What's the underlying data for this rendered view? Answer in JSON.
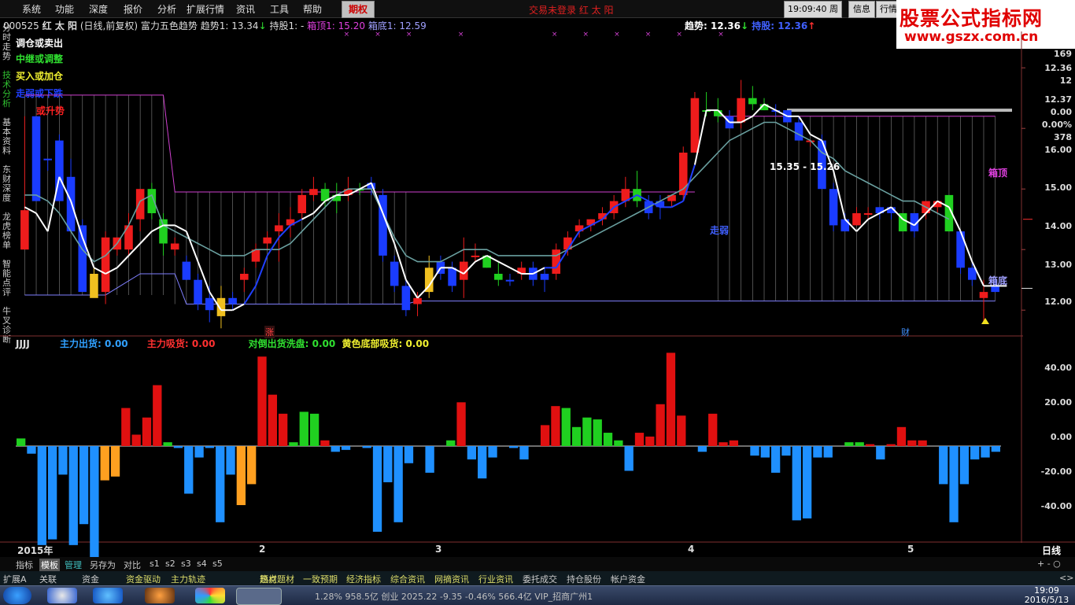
{
  "menubar": {
    "items": [
      "系统",
      "功能",
      "深度",
      "报价",
      "分析",
      "扩展行情",
      "资讯",
      "工具",
      "帮助"
    ],
    "active_tab": "期权",
    "status": "交易未登录   红 太 阳",
    "clock": "19:09:40",
    "weekday": "周五",
    "right_buttons": [
      "信息",
      "行情"
    ]
  },
  "logo": {
    "title": "股票公式指标网",
    "url": "www.gszx.com.cn"
  },
  "left_tabs": [
    "分时走势",
    "技术分析",
    "基本资料",
    "东财深度",
    "龙虎榜单",
    "智能点评",
    "牛叉诊断"
  ],
  "info": {
    "code": "000525",
    "name": "红 太 阳",
    "period": "(日线,前复权)",
    "indicator": "富力五色趋势",
    "trend_label": "趋势1:",
    "trend_value": "13.34",
    "hold_label": "持股1:",
    "hold_value": "-",
    "top_label": "箱顶1:",
    "top_value": "15.20",
    "bottom_label": "箱底1:",
    "bottom_value": "12.59",
    "trend2_label": "趋势:",
    "trend2_value": "12.36",
    "hold2_label": "持股:",
    "hold2_value": "12.36"
  },
  "legend": [
    {
      "text": "调仓或卖出",
      "color": "#ffffff"
    },
    {
      "text": "中继或调整",
      "color": "#30e030"
    },
    {
      "text": "买入或加仓",
      "color": "#f0f030"
    },
    {
      "text": "走弱或下跌",
      "color": "#2040ff"
    },
    {
      "text": "或升势",
      "color": "#ff2020"
    }
  ],
  "annotations": {
    "range_label": "15.35 - 15.26",
    "box_top": "箱顶",
    "box_bottom": "箱底",
    "trend_tag": "走弱",
    "zhang": "涨",
    "cai": "财"
  },
  "right_scale": [
    "169",
    "12.36",
    "12",
    "12.37",
    "0.00",
    "0.00%",
    "378",
    "16.00",
    "15.00",
    "14.00",
    "13.00",
    "12.00"
  ],
  "sub_indicator": {
    "name": "JJJJ",
    "main_out_label": "主力出货:",
    "main_out_value": "0.00",
    "main_in_label": "主力吸货:",
    "main_in_value": "0.00",
    "wash_label": "对倒出货洗盘:",
    "wash_value": "0.00",
    "yellow_label": "黄色底部吸货:",
    "yellow_value": "0.00",
    "ticks": [
      "40.00",
      "20.00",
      "0.00",
      "-20.00",
      "-40.00"
    ]
  },
  "x_axis": {
    "year": "2015年",
    "months": [
      "2",
      "3",
      "4",
      "5"
    ],
    "right_label": "日线"
  },
  "toolbar2": {
    "items": [
      "指标",
      "模板",
      "管理",
      "另存为",
      "对比",
      "s1",
      "s2",
      "s3",
      "s4",
      "s5"
    ],
    "right": "+ - ○"
  },
  "linkbar": {
    "items": [
      "扩展A",
      "关联",
      "资金",
      "资金驱动",
      "主力轨迹",
      "",
      "题材",
      "热点题材",
      "一致预期",
      "经济指标",
      "综合资讯",
      "网摘资讯",
      "行业资讯",
      "委托成交",
      "持仓股份",
      "帐户资金"
    ],
    "right": "<>"
  },
  "ticker": {
    "text": "1.28%   958.5亿   创业 2025.22   -9.35   -0.46%   566.4亿   VIP_招商广州1"
  },
  "taskbar": {
    "time": "19:09",
    "date": "2016/5/13"
  },
  "chart_data": [
    {
      "type": "candlestick",
      "title": "",
      "ylim": [
        11.6,
        16.6
      ],
      "y_ticks": [
        16,
        15,
        14,
        13,
        12
      ],
      "ohlc": [
        [
          13.65,
          15.2,
          13.2,
          13.0,
          "u"
        ],
        [
          15.2,
          15.2,
          13.8,
          13.8,
          "d"
        ],
        [
          14.5,
          14.5,
          14.3,
          14.5,
          "d"
        ],
        [
          14.8,
          14.9,
          13.8,
          13.8,
          "d"
        ],
        [
          14.2,
          14.5,
          13.4,
          13.3,
          "d"
        ],
        [
          13.4,
          13.5,
          12.4,
          12.3,
          "d"
        ],
        [
          12.6,
          12.7,
          12.3,
          12.2,
          "y"
        ],
        [
          12.3,
          13.3,
          12.1,
          13.2,
          "u"
        ],
        [
          13.0,
          13.2,
          12.9,
          13.2,
          "u"
        ],
        [
          13.0,
          13.6,
          12.9,
          13.4,
          "u"
        ],
        [
          13.5,
          14.0,
          13.3,
          14.0,
          "u"
        ],
        [
          14.0,
          14.1,
          13.5,
          13.6,
          "g"
        ],
        [
          13.5,
          13.6,
          12.9,
          13.1,
          "g"
        ],
        [
          13.1,
          13.2,
          12.9,
          13.0,
          "u"
        ],
        [
          12.8,
          12.9,
          12.5,
          12.5,
          "d"
        ],
        [
          12.5,
          12.6,
          12.0,
          12.1,
          "d"
        ],
        [
          12.2,
          12.4,
          11.8,
          12.0,
          "d"
        ],
        [
          12.2,
          12.4,
          11.7,
          11.9,
          "y"
        ],
        [
          12.1,
          12.3,
          12.0,
          12.2,
          "d"
        ],
        [
          12.5,
          12.7,
          12.3,
          12.6,
          "u"
        ],
        [
          12.8,
          13.1,
          12.7,
          13.0,
          "u"
        ],
        [
          13.1,
          13.3,
          13.0,
          13.2,
          "u"
        ],
        [
          13.3,
          13.6,
          12.8,
          13.4,
          "u"
        ],
        [
          13.4,
          13.7,
          13.2,
          13.5,
          "u"
        ],
        [
          13.6,
          14.0,
          13.5,
          13.9,
          "u"
        ],
        [
          13.9,
          14.2,
          13.8,
          14.0,
          "u"
        ],
        [
          14.0,
          14.1,
          13.7,
          13.8,
          "g"
        ],
        [
          13.8,
          14.1,
          13.6,
          13.9,
          "g"
        ],
        [
          13.9,
          14.2,
          13.8,
          14.0,
          "u"
        ],
        [
          14.0,
          14.1,
          13.9,
          14.0,
          "g"
        ],
        [
          14.0,
          14.2,
          13.9,
          14.1,
          "d"
        ],
        [
          13.9,
          14.0,
          12.8,
          12.9,
          "d"
        ],
        [
          12.8,
          12.9,
          12.3,
          12.4,
          "d"
        ],
        [
          12.4,
          12.5,
          11.9,
          12.0,
          "d"
        ],
        [
          12.1,
          12.3,
          11.9,
          12.2,
          "u"
        ],
        [
          12.3,
          12.9,
          12.2,
          12.7,
          "y"
        ],
        [
          12.8,
          12.9,
          12.5,
          12.6,
          "d"
        ],
        [
          12.7,
          12.8,
          12.3,
          12.4,
          "d"
        ],
        [
          12.5,
          13.2,
          12.2,
          12.8,
          "u"
        ],
        [
          12.9,
          13.1,
          12.8,
          12.9,
          "u"
        ],
        [
          12.9,
          12.9,
          12.7,
          12.7,
          "g"
        ],
        [
          12.6,
          12.8,
          12.4,
          12.5,
          "g"
        ],
        [
          12.5,
          12.6,
          12.4,
          12.5,
          "d"
        ],
        [
          12.6,
          12.8,
          12.5,
          12.7,
          "u"
        ],
        [
          12.7,
          12.8,
          12.4,
          12.5,
          "d"
        ],
        [
          12.5,
          12.7,
          12.3,
          12.6,
          "d"
        ],
        [
          12.6,
          13.1,
          12.5,
          13.0,
          "u"
        ],
        [
          13.0,
          13.3,
          12.9,
          13.2,
          "u"
        ],
        [
          13.3,
          13.5,
          13.2,
          13.4,
          "u"
        ],
        [
          13.4,
          13.5,
          13.3,
          13.5,
          "u"
        ],
        [
          13.5,
          13.7,
          13.4,
          13.6,
          "u"
        ],
        [
          13.6,
          13.9,
          13.5,
          13.8,
          "u"
        ],
        [
          13.8,
          14.2,
          13.7,
          14.0,
          "u"
        ],
        [
          14.0,
          14.3,
          13.7,
          13.8,
          "g"
        ],
        [
          13.8,
          13.9,
          13.5,
          13.6,
          "d"
        ],
        [
          13.7,
          13.9,
          13.5,
          13.8,
          "d"
        ],
        [
          13.8,
          13.9,
          13.7,
          13.9,
          "u"
        ],
        [
          13.9,
          14.7,
          13.8,
          14.6,
          "u"
        ],
        [
          14.6,
          15.6,
          14.6,
          15.5,
          "u"
        ],
        [
          15.3,
          15.6,
          15.2,
          15.3,
          "g"
        ],
        [
          15.3,
          15.5,
          15.1,
          15.2,
          "g"
        ],
        [
          15.2,
          15.3,
          15.0,
          15.0,
          "d"
        ],
        [
          15.1,
          15.8,
          15.0,
          15.5,
          "u"
        ],
        [
          15.4,
          15.7,
          15.3,
          15.5,
          "g"
        ],
        [
          15.4,
          15.5,
          15.3,
          15.3,
          "g"
        ],
        [
          15.3,
          15.4,
          15.2,
          15.3,
          "d"
        ],
        [
          15.3,
          15.3,
          15.1,
          15.1,
          "d"
        ],
        [
          15.1,
          15.2,
          14.8,
          14.8,
          "d"
        ],
        [
          14.8,
          14.8,
          14.7,
          14.8,
          "u"
        ],
        [
          14.8,
          14.9,
          14.0,
          14.0,
          "d"
        ],
        [
          14.0,
          14.1,
          13.3,
          13.4,
          "d"
        ],
        [
          13.5,
          13.6,
          13.3,
          13.3,
          "d"
        ],
        [
          13.4,
          13.7,
          13.4,
          13.6,
          "u"
        ],
        [
          13.6,
          13.7,
          13.5,
          13.6,
          "u"
        ],
        [
          13.6,
          13.7,
          13.5,
          13.7,
          "d"
        ],
        [
          13.7,
          13.7,
          13.5,
          13.6,
          "d"
        ],
        [
          13.6,
          13.6,
          13.3,
          13.3,
          "g"
        ],
        [
          13.3,
          13.6,
          13.2,
          13.6,
          "d"
        ],
        [
          13.6,
          13.8,
          13.5,
          13.8,
          "u"
        ],
        [
          13.8,
          13.8,
          13.6,
          13.7,
          "u"
        ],
        [
          13.9,
          13.9,
          13.3,
          13.3,
          "g"
        ],
        [
          13.3,
          13.3,
          12.6,
          12.7,
          "d"
        ],
        [
          12.7,
          12.8,
          12.4,
          12.5,
          "d"
        ],
        [
          12.3,
          12.5,
          11.8,
          12.2,
          "u"
        ],
        [
          12.3,
          12.5,
          12.3,
          12.4,
          "d"
        ]
      ],
      "trend_line": [
        13.7,
        13.6,
        13.3,
        14.2,
        13.8,
        13.2,
        12.7,
        12.6,
        12.7,
        12.9,
        13.1,
        13.3,
        13.4,
        13.4,
        13.3,
        12.8,
        12.3,
        12.0,
        12.0,
        12.1,
        12.4,
        12.9,
        13.2,
        13.4,
        13.5,
        13.6,
        13.8,
        13.9,
        13.9,
        14.0,
        14.1,
        13.6,
        13.1,
        12.5,
        12.2,
        12.4,
        12.7,
        12.7,
        12.6,
        12.8,
        12.9,
        12.8,
        12.7,
        12.6,
        12.6,
        12.7,
        12.7,
        13.0,
        13.3,
        13.4,
        13.5,
        13.7,
        13.8,
        13.9,
        13.8,
        13.7,
        13.7,
        13.8,
        14.4,
        15.3,
        15.3,
        15.1,
        15.1,
        15.2,
        15.4,
        15.3,
        15.2,
        15.2,
        14.9,
        14.8,
        14.3,
        13.5,
        13.3,
        13.5,
        13.6,
        13.7,
        13.5,
        13.4,
        13.6,
        13.8,
        13.7,
        13.3,
        12.8,
        12.4,
        12.4,
        12.4
      ],
      "ma_line": [
        13.9,
        13.9,
        13.8,
        13.6,
        13.3,
        13.0,
        12.8,
        12.9,
        13.1,
        13.4,
        13.8,
        13.9,
        13.4,
        13.3,
        13.2,
        13.1,
        13.0,
        12.9,
        12.9,
        12.9,
        13.0,
        13.0,
        13.0,
        13.1,
        13.3,
        13.5,
        13.7,
        13.9,
        14.0,
        14.0,
        14.0,
        13.6,
        13.2,
        12.9,
        12.8,
        12.8,
        12.8,
        12.9,
        13.0,
        13.0,
        13.0,
        12.9,
        12.9,
        12.9,
        12.9,
        12.9,
        12.9,
        13.0,
        13.1,
        13.2,
        13.3,
        13.4,
        13.5,
        13.6,
        13.7,
        13.8,
        13.9,
        14.0,
        14.2,
        14.4,
        14.6,
        14.8,
        14.9,
        15.0,
        15.1,
        15.1,
        15.0,
        14.9,
        14.8,
        14.6,
        14.5,
        14.3,
        14.2,
        14.1,
        14.0,
        13.9,
        13.8,
        13.8,
        13.7,
        13.6,
        13.5
      ]
    },
    {
      "type": "bar",
      "title": "",
      "ylim": [
        -50,
        50
      ],
      "values": [
        4,
        -4,
        -52,
        -49,
        -15,
        -52,
        -41,
        -60,
        -18,
        -16,
        20,
        6,
        15,
        32,
        2,
        -1,
        -25,
        -6,
        -1,
        -40,
        -15,
        -31,
        -20,
        47,
        27,
        17,
        2,
        18,
        17,
        3,
        -3,
        -2,
        0,
        -1,
        -45,
        -19,
        -40,
        -9,
        0,
        -14,
        0,
        3,
        23,
        -7,
        -17,
        -6,
        0,
        -1,
        -7,
        0,
        11,
        21,
        20,
        10,
        15,
        14,
        7,
        3,
        -13,
        7,
        5,
        22,
        49,
        16,
        0,
        -3,
        17,
        2,
        3,
        0,
        -5,
        -6,
        -14,
        -5,
        -39,
        -38,
        -6,
        -6,
        0,
        2,
        2,
        1,
        -7,
        1,
        10,
        3,
        3,
        0,
        -20,
        -40,
        -20,
        -7,
        -6,
        -3
      ],
      "colors": "red positive, light blue negative, green/orange special"
    }
  ]
}
